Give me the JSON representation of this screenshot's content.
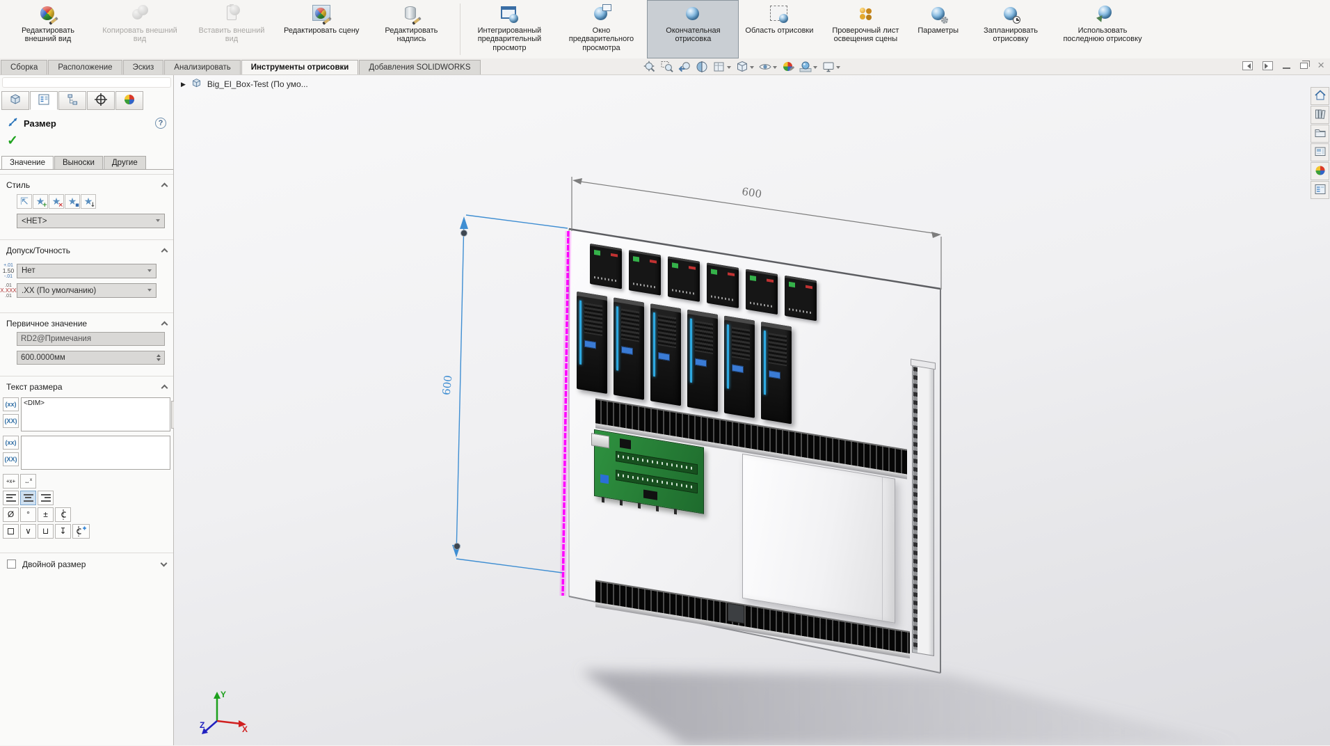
{
  "ribbon": {
    "buttons": [
      {
        "id": "edit-appearance",
        "label": "Редактировать внешний вид"
      },
      {
        "id": "copy-appearance",
        "label": "Копировать внешний вид",
        "disabled": true
      },
      {
        "id": "paste-appearance",
        "label": "Вставить внешний вид",
        "disabled": true
      },
      {
        "id": "edit-scene",
        "label": "Редактировать сцену"
      },
      {
        "id": "edit-decal",
        "label": "Редактировать надпись"
      },
      {
        "id": "integrated-preview",
        "label": "Интегрированный предварительный просмотр",
        "group_start": true
      },
      {
        "id": "preview-window",
        "label": "Окно предварительного просмотра"
      },
      {
        "id": "final-render",
        "label": "Окончательная отрисовка",
        "selected": true
      },
      {
        "id": "render-region",
        "label": "Область отрисовки"
      },
      {
        "id": "lighting-checklist",
        "label": "Проверочный лист освещения сцены"
      },
      {
        "id": "options",
        "label": "Параметры"
      },
      {
        "id": "schedule-render",
        "label": "Запланировать отрисовку"
      },
      {
        "id": "recall-render",
        "label": "Использовать последнюю отрисовку"
      }
    ]
  },
  "tab_bar": {
    "tabs": [
      {
        "id": "assembly",
        "label": "Сборка"
      },
      {
        "id": "layout",
        "label": "Расположение"
      },
      {
        "id": "sketch",
        "label": "Эскиз"
      },
      {
        "id": "evaluate",
        "label": "Анализировать"
      },
      {
        "id": "render-tools",
        "label": "Инструменты отрисовки",
        "active": true
      },
      {
        "id": "solidworks-addins",
        "label": "Добавления SOLIDWORKS"
      }
    ]
  },
  "hud": {
    "icons": [
      {
        "id": "zoom-fit"
      },
      {
        "id": "zoom-area"
      },
      {
        "id": "previous-view"
      },
      {
        "id": "section-view"
      },
      {
        "id": "display-style",
        "dropdown": true
      },
      {
        "id": "view-orientation",
        "dropdown": true
      },
      {
        "id": "hide-show",
        "dropdown": true
      },
      {
        "id": "edit-appearance"
      },
      {
        "id": "apply-scene",
        "dropdown": true
      },
      {
        "id": "view-settings",
        "dropdown": true
      }
    ]
  },
  "window_controls": [
    {
      "id": "collapse-left-pane"
    },
    {
      "id": "collapse-right-pane"
    },
    {
      "id": "minimize"
    },
    {
      "id": "restore"
    },
    {
      "id": "close"
    }
  ],
  "property_manager": {
    "tabs": [
      {
        "id": "features"
      },
      {
        "id": "properties",
        "active": true
      },
      {
        "id": "configurations"
      },
      {
        "id": "dimxpert"
      },
      {
        "id": "display"
      }
    ],
    "title": "Размер",
    "help_glyph": "?",
    "accept_glyph": "✓",
    "value_tabs": [
      {
        "id": "value",
        "label": "Значение",
        "active": true
      },
      {
        "id": "leaders",
        "label": "Выноски"
      },
      {
        "id": "other",
        "label": "Другие"
      }
    ],
    "style": {
      "header": "Стиль",
      "selected": "<НЕТ>",
      "buttons": [
        {
          "id": "apply-default-style",
          "glyph": "⇱",
          "ovl": ""
        },
        {
          "id": "add-style",
          "glyph": "★",
          "ovl": "+",
          "ovl_color": "#2a8f2a"
        },
        {
          "id": "delete-style",
          "glyph": "★",
          "ovl": "×",
          "ovl_color": "#c33"
        },
        {
          "id": "save-style",
          "glyph": "★",
          "ovl": "▪",
          "ovl_color": "#3a6fae"
        },
        {
          "id": "load-style",
          "glyph": "★",
          "ovl": "↓",
          "ovl_color": "#444"
        }
      ]
    },
    "tolerance": {
      "header": "Допуск/Точность",
      "type_value": "Нет",
      "precision_value": ".XX (По умолчанию)"
    },
    "primary_value": {
      "header": "Первичное значение",
      "name": "RD2@Примечания",
      "value": "600.0000мм"
    },
    "dimension_text": {
      "header": "Текст размера",
      "text": "<DIM>",
      "text2": ""
    },
    "symbol_rows": [
      [
        {
          "id": "text-offset"
        },
        {
          "id": "text-offset-x"
        }
      ],
      [
        {
          "id": "align-left"
        },
        {
          "id": "align-center",
          "selected": true
        },
        {
          "id": "align-right"
        }
      ],
      [
        {
          "id": "diameter",
          "glyph": "Ø"
        },
        {
          "id": "degree",
          "glyph": "°"
        },
        {
          "id": "plus-minus",
          "glyph": "±"
        },
        {
          "id": "centerline"
        }
      ],
      [
        {
          "id": "square"
        },
        {
          "id": "countersink",
          "glyph": "∨"
        },
        {
          "id": "counterbore",
          "glyph": "⊔"
        },
        {
          "id": "depth",
          "glyph": "↧"
        },
        {
          "id": "more-symbols"
        }
      ]
    ],
    "dual_dimension": {
      "label": "Двойной размер",
      "checked": false
    }
  },
  "feature_tree": {
    "label": "Big_El_Box-Test  (По умо...",
    "caret": "▶"
  },
  "viewport": {
    "dim_top": {
      "value": "600"
    },
    "dim_left": {
      "value": "600",
      "selected": true
    },
    "triad": {
      "x": "X",
      "y": "Y",
      "z": "Z"
    },
    "colors": {
      "selection": "#ff00ff",
      "dimension_selected": "#3f8ed2",
      "dimension": "#7a7a7a"
    }
  },
  "task_pane": {
    "icons": [
      {
        "id": "home"
      },
      {
        "id": "design-library"
      },
      {
        "id": "file-explorer"
      },
      {
        "id": "view-palette"
      },
      {
        "id": "appearances-scenes"
      },
      {
        "id": "custom-properties"
      }
    ]
  },
  "scene": {
    "modules_small": 6,
    "modules_large": 6
  }
}
